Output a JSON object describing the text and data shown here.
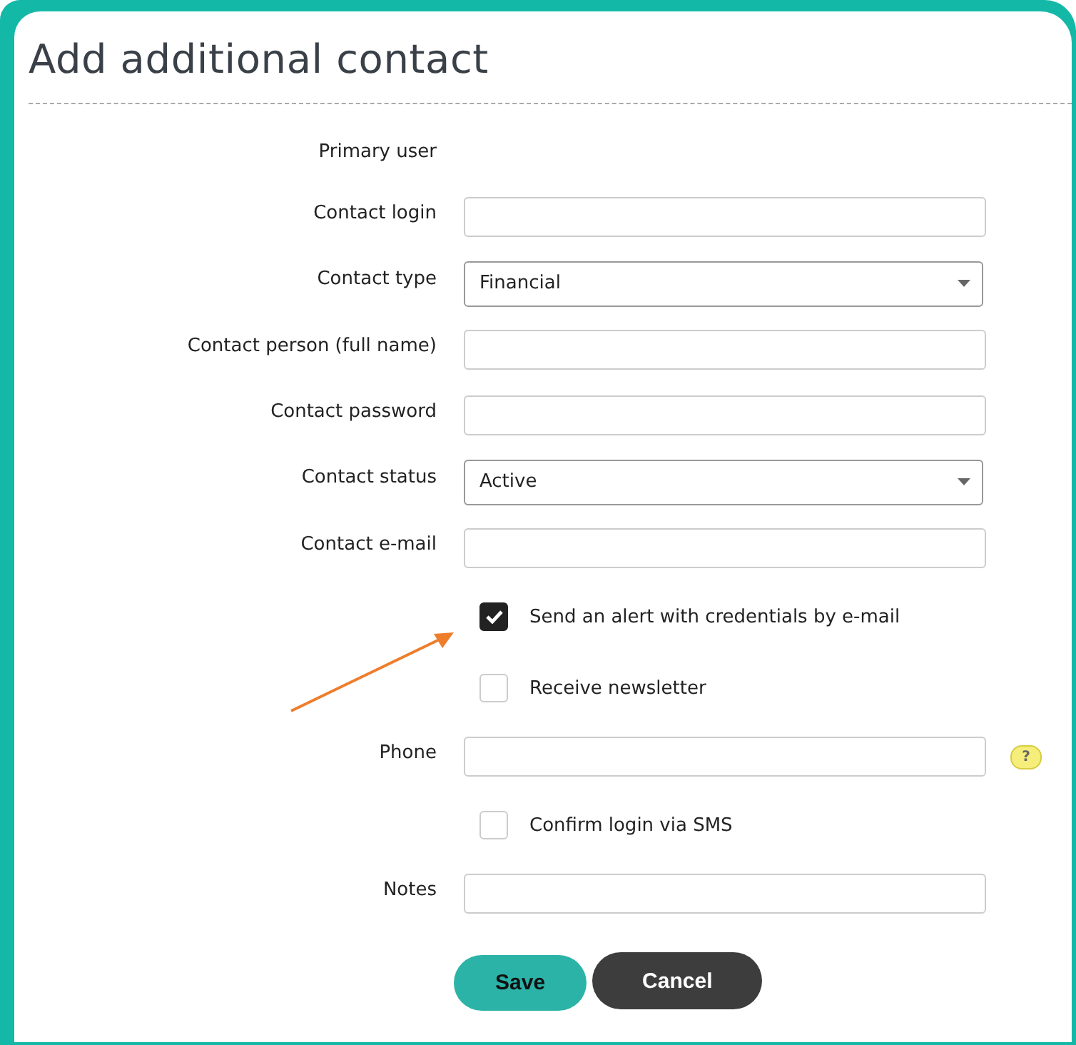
{
  "title": "Add additional contact",
  "fields": [
    {
      "kind": "static",
      "label": "Primary user"
    },
    {
      "kind": "text",
      "label": "Contact login"
    },
    {
      "kind": "select",
      "label": "Contact type",
      "value": "Financial"
    },
    {
      "kind": "text",
      "label": "Contact person (full name)"
    },
    {
      "kind": "text",
      "label": "Contact password"
    },
    {
      "kind": "select",
      "label": "Contact status",
      "value": "Active"
    },
    {
      "kind": "text",
      "label": "Contact e-mail"
    },
    {
      "kind": "checkbox",
      "label": "Send an alert with credentials by e-mail",
      "checked": true
    },
    {
      "kind": "checkbox",
      "label": "Receive newsletter",
      "checked": false
    },
    {
      "kind": "text",
      "label": "Phone",
      "help": "?"
    },
    {
      "kind": "checkbox",
      "label": "Confirm login via SMS",
      "checked": false
    },
    {
      "kind": "text",
      "label": "Notes"
    }
  ],
  "buttons": [
    {
      "label": "Save",
      "kind": "primary"
    },
    {
      "label": "Cancel",
      "kind": "secondary"
    }
  ]
}
